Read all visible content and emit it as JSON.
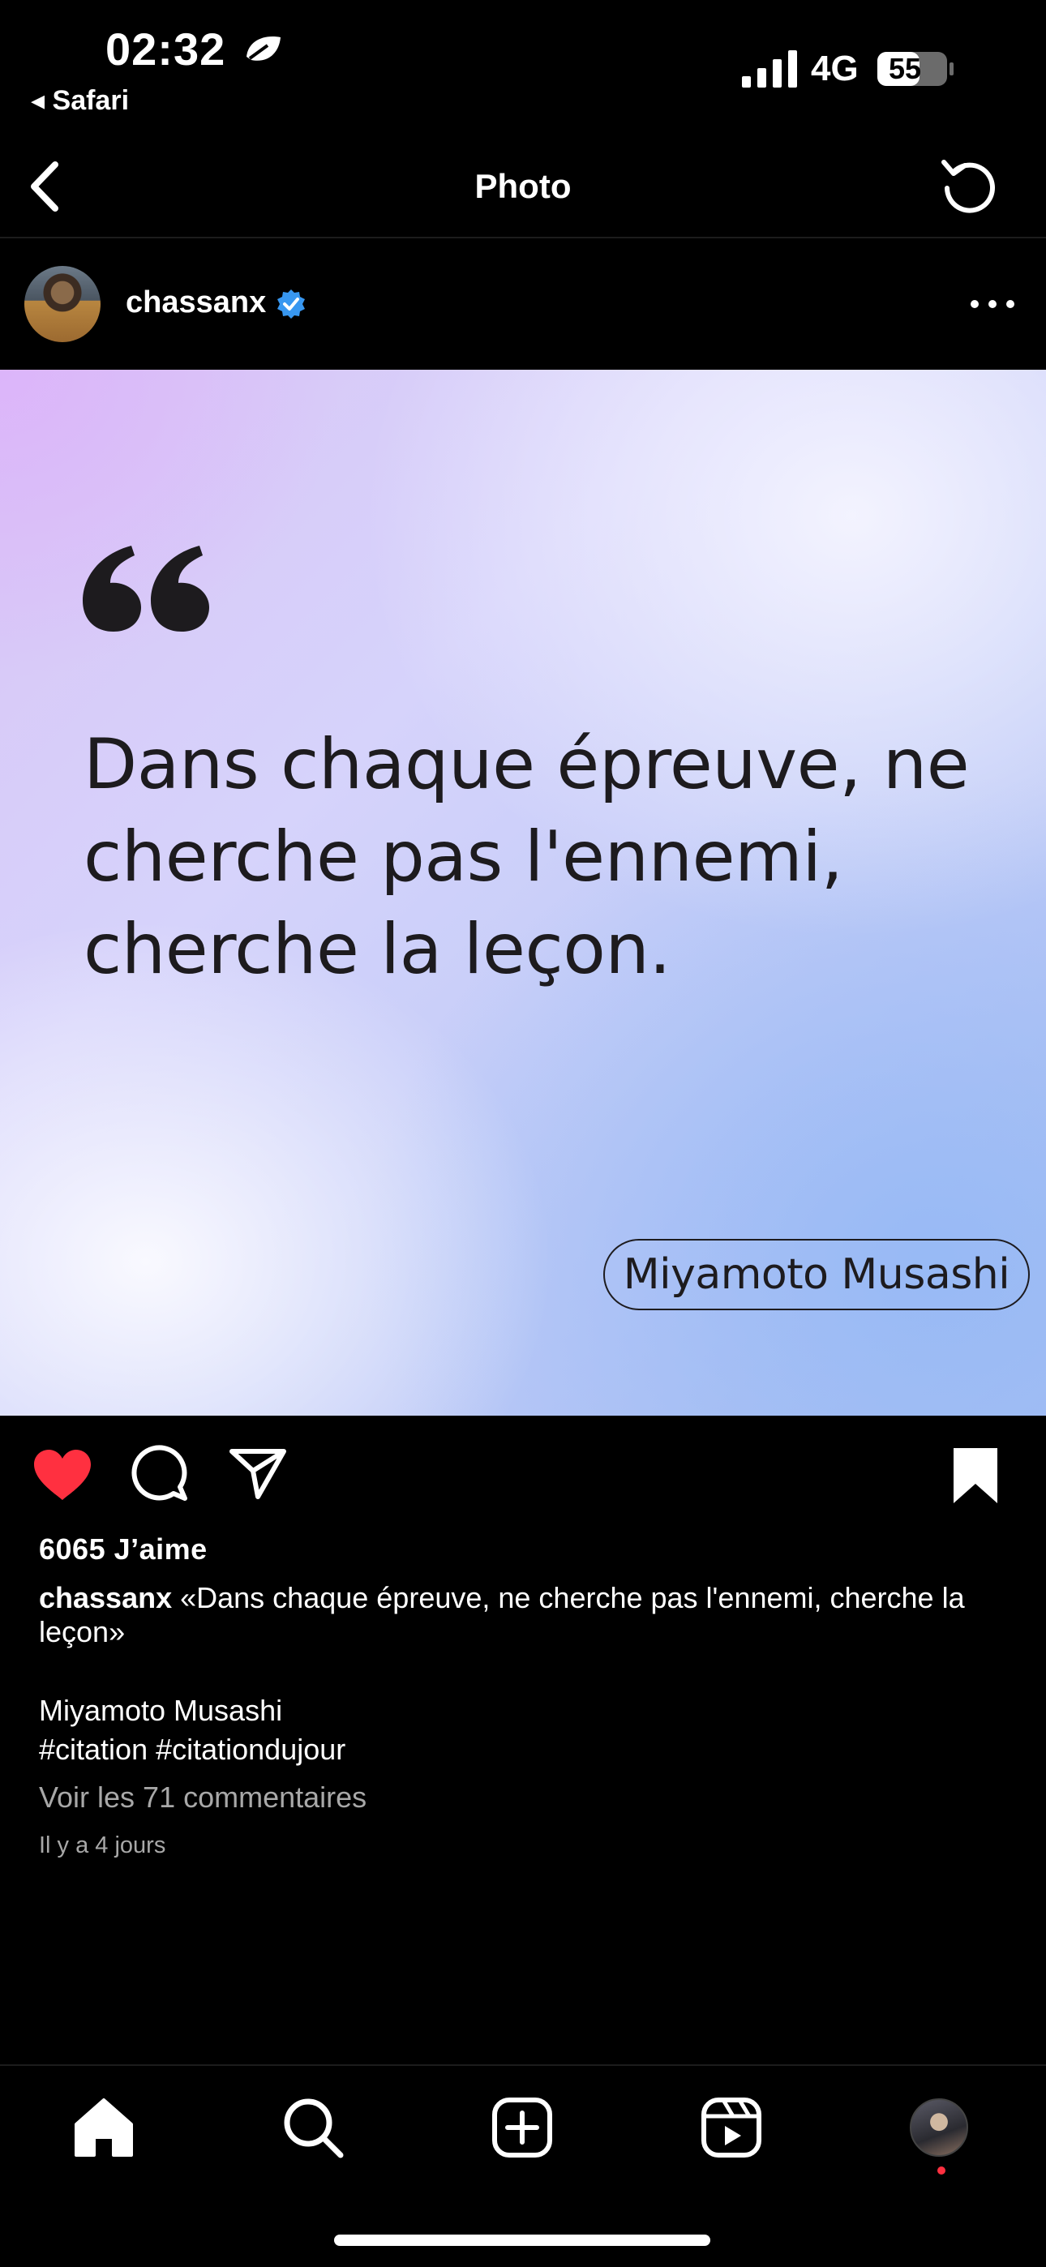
{
  "status_bar": {
    "time": "02:32",
    "back_app": "◂ Safari",
    "network": "4G",
    "battery": "55"
  },
  "nav": {
    "title": "Photo"
  },
  "post": {
    "username": "chassanx",
    "quote_text": "Dans chaque épreuve, ne cherche pas l'ennemi, cherche la leçon.",
    "author": "Miyamoto Musashi",
    "likes": "6065 J’aime",
    "caption_user": "chassanx",
    "caption_text": " «Dans chaque épreuve, ne cherche pas l'ennemi, cherche la leçon»",
    "caption_author": "Miyamoto Musashi",
    "hashtags": "#citation #citationdujour",
    "comments_link": "Voir les 71 commentaires",
    "time_ago": "Il y a 4 jours",
    "liked": true,
    "saved": true
  },
  "colors": {
    "like_red": "#ff3040",
    "verified_blue": "#3897f0",
    "muted_text": "#a8a8a8"
  },
  "tabs": [
    "home-icon",
    "search-icon",
    "create-icon",
    "reels-icon",
    "profile-avatar"
  ]
}
